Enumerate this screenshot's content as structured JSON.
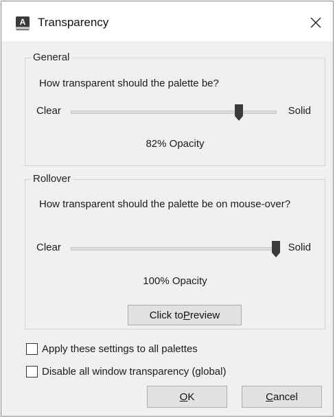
{
  "window": {
    "title": "Transparency",
    "icon": "autocad-app-icon",
    "icon_glyph": "A"
  },
  "general": {
    "legend": "General",
    "prompt": "How transparent should the palette be?",
    "min_label": "Clear",
    "max_label": "Solid",
    "opacity_percent": 82,
    "opacity_text": "82% Opacity"
  },
  "rollover": {
    "legend": "Rollover",
    "prompt": "How transparent should the palette be on mouse-over?",
    "min_label": "Clear",
    "max_label": "Solid",
    "opacity_percent": 100,
    "opacity_text": "100% Opacity",
    "preview_button": {
      "before": "Click to ",
      "mnemonic": "P",
      "after": "review"
    }
  },
  "options": {
    "apply_all": {
      "label": "Apply these settings to all palettes",
      "checked": false
    },
    "disable_all": {
      "label": "Disable all window transparency (global)",
      "checked": false
    }
  },
  "buttons": {
    "ok": {
      "mnemonic": "O",
      "rest": "K"
    },
    "cancel": {
      "mnemonic": "C",
      "rest": "ancel"
    }
  }
}
